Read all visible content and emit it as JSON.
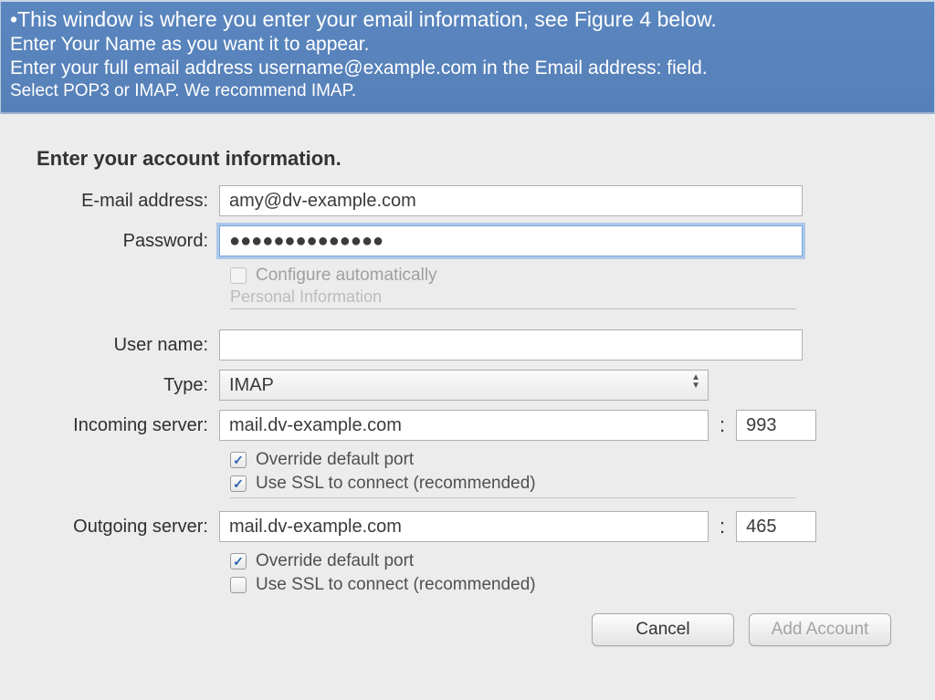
{
  "banner": {
    "line1": "•This window is where you enter your email information, see Figure 4 below.",
    "line2": "Enter Your Name as you want it to appear.",
    "line3": "Enter your full email address username@example.com in the Email address: field.",
    "line4": "Select POP3 or IMAP. We recommend IMAP."
  },
  "heading": "Enter your account information.",
  "labels": {
    "email": "E-mail address:",
    "password": "Password:",
    "configure_auto": "Configure automatically",
    "username": "User name:",
    "type": "Type:",
    "incoming": "Incoming server:",
    "outgoing": "Outgoing server:",
    "override_port": "Override default port",
    "use_ssl": "Use SSL to connect (recommended)"
  },
  "ghost": {
    "personal_info": "Personal Information"
  },
  "values": {
    "email": "amy@dv-example.com",
    "password": "●●●●●●●●●●●●●●",
    "username": "",
    "type_selected": "IMAP",
    "incoming_server": "mail.dv-example.com",
    "incoming_port": "993",
    "outgoing_server": "mail.dv-example.com",
    "outgoing_port": "465"
  },
  "checks": {
    "configure_auto": false,
    "incoming_override": true,
    "incoming_ssl": true,
    "outgoing_override": true,
    "outgoing_ssl": false
  },
  "buttons": {
    "cancel": "Cancel",
    "add_account": "Add Account"
  }
}
